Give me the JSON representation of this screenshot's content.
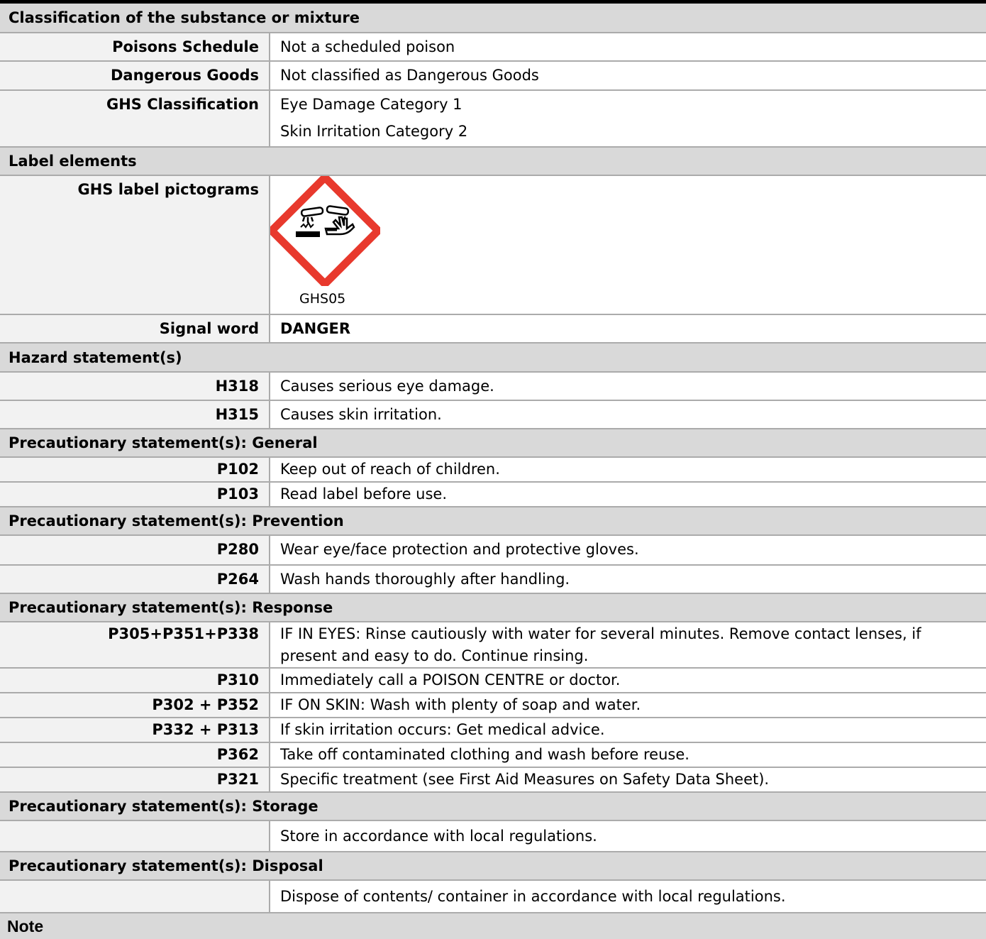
{
  "classification": {
    "heading": "Classification of the substance or mixture",
    "rows": [
      {
        "label": "Poisons Schedule",
        "value": "Not a scheduled poison"
      },
      {
        "label": "Dangerous Goods",
        "value": "Not classified as Dangerous Goods"
      },
      {
        "label": "GHS Classification",
        "values": [
          "Eye Damage Category 1",
          "Skin Irritation Category 2"
        ]
      }
    ]
  },
  "label_elements": {
    "heading": "Label elements",
    "pictograms_label": "GHS label pictograms",
    "pictogram": {
      "icon": "corrosion-icon",
      "code": "GHS05",
      "border_color": "#e8392d"
    },
    "signal_word_label": "Signal word",
    "signal_word": "DANGER"
  },
  "hazard": {
    "heading": "Hazard statement(s)",
    "rows": [
      {
        "code": "H318",
        "text": "Causes serious eye damage."
      },
      {
        "code": "H315",
        "text": "Causes skin irritation."
      }
    ]
  },
  "general": {
    "heading": "Precautionary statement(s): General",
    "rows": [
      {
        "code": "P102",
        "text": "Keep out of reach of children."
      },
      {
        "code": "P103",
        "text": "Read label before use."
      }
    ]
  },
  "prevention": {
    "heading": "Precautionary statement(s): Prevention",
    "rows": [
      {
        "code": "P280",
        "text": "Wear eye/face protection and protective gloves."
      },
      {
        "code": "P264",
        "text": "Wash hands thoroughly after handling."
      }
    ]
  },
  "response": {
    "heading": "Precautionary statement(s): Response",
    "rows": [
      {
        "code": "P305+P351+P338",
        "lines": [
          "IF IN EYES: Rinse cautiously with water for several minutes. Remove contact lenses, if",
          "present and easy to do. Continue rinsing."
        ]
      },
      {
        "code": "P310",
        "text": "Immediately call a POISON CENTRE or doctor."
      },
      {
        "code": "P302 + P352",
        "text": "IF ON SKIN: Wash with plenty of soap and water."
      },
      {
        "code": "P332 + P313",
        "text": "If skin irritation occurs: Get medical advice."
      },
      {
        "code": "P362",
        "text": "Take off contaminated clothing and wash before reuse."
      },
      {
        "code": "P321",
        "text": "Specific treatment (see First Aid Measures on Safety Data Sheet)."
      }
    ]
  },
  "storage": {
    "heading": "Precautionary statement(s): Storage",
    "text": "Store in accordance with local regulations."
  },
  "disposal": {
    "heading": "Precautionary statement(s): Disposal",
    "text": "Dispose of contents/ container in accordance with local regulations."
  },
  "note": {
    "heading": "Note"
  }
}
